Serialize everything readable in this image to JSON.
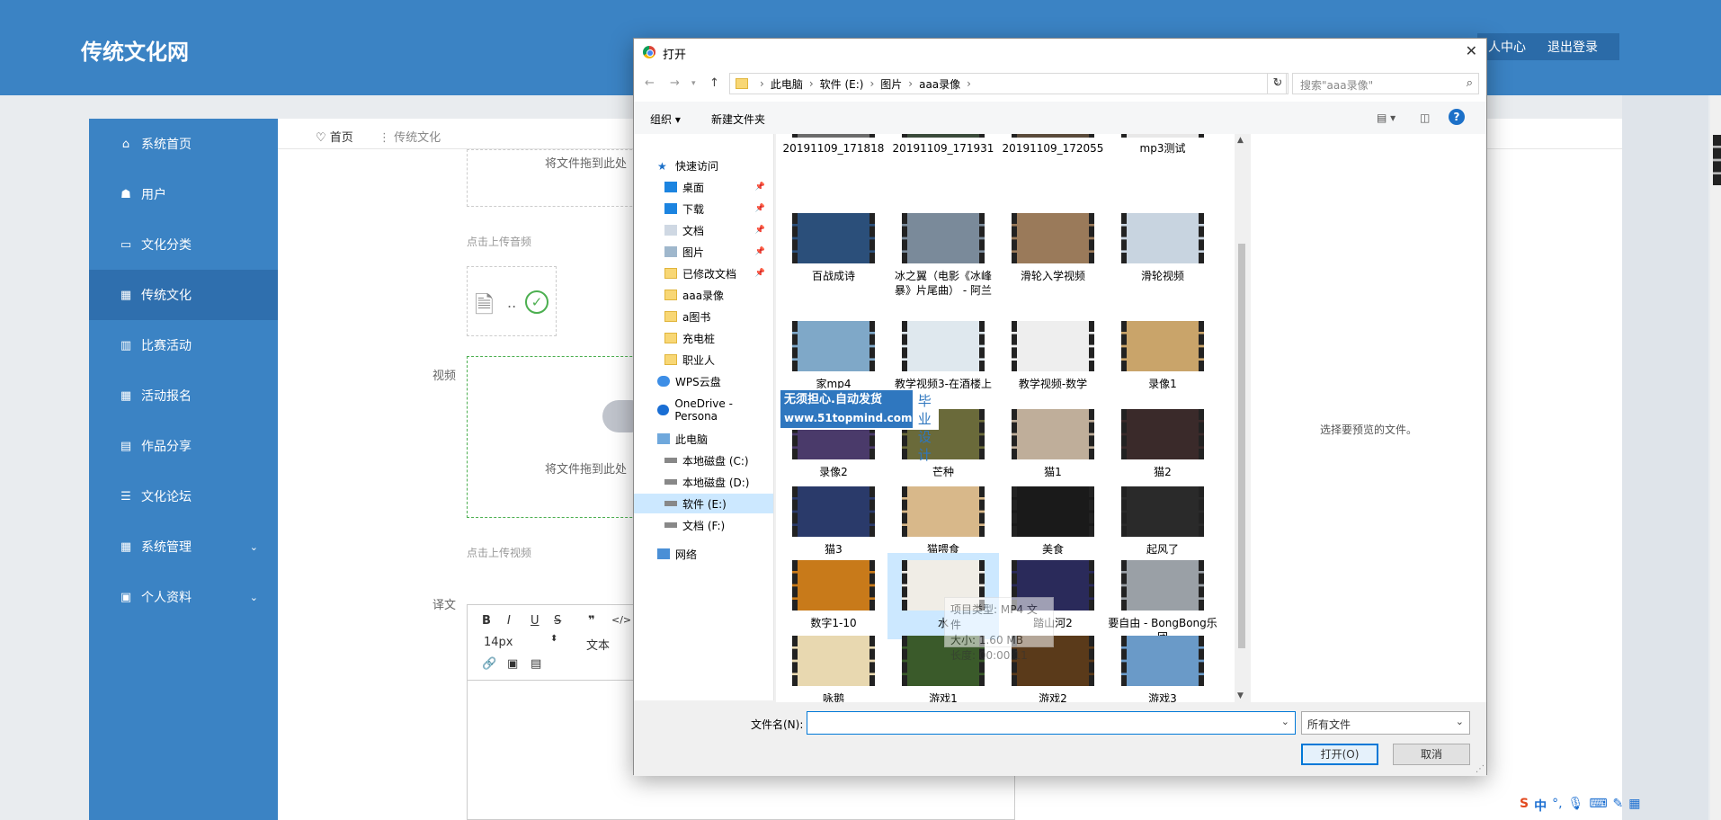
{
  "app": {
    "brand": "传统文化网",
    "top_buttons": [
      "人中心",
      "退出登录"
    ]
  },
  "sidebar": {
    "items": [
      {
        "icon": "home-icon",
        "label": "系统首页"
      },
      {
        "icon": "user-icon",
        "label": "用户"
      },
      {
        "icon": "monitor-icon",
        "label": "文化分类"
      },
      {
        "icon": "grid-icon",
        "label": "传统文化",
        "active": true
      },
      {
        "icon": "bar-chart-icon",
        "label": "比赛活动"
      },
      {
        "icon": "grid-icon",
        "label": "活动报名"
      },
      {
        "icon": "comment-icon",
        "label": "作品分享"
      },
      {
        "icon": "list-icon",
        "label": "文化论坛"
      },
      {
        "icon": "grid-icon",
        "label": "系统管理",
        "has_chevron": true
      },
      {
        "icon": "profile-icon",
        "label": "个人资料",
        "has_chevron": true
      }
    ]
  },
  "breadcrumb": {
    "home": "首页",
    "current": "传统文化"
  },
  "form": {
    "drop_text_audio": "将文件拖到此处",
    "upload_audio_hint": "点击上传音频",
    "video_label": "视频",
    "drop_text_video": "将文件拖到此处",
    "upload_video_hint": "点击上传视频",
    "translation_label": "译文",
    "editor_font_size": "14px",
    "editor_text_type": "文本"
  },
  "dialog": {
    "title": "打开",
    "path": [
      "此电脑",
      "软件 (E:)",
      "图片",
      "aaa录像"
    ],
    "search_placeholder": "搜索\"aaa录像\"",
    "toolbar": {
      "organize": "组织 ▾",
      "new_folder": "新建文件夹"
    },
    "nav": {
      "quick_access": "快速访问",
      "quick_items": [
        {
          "label": "桌面",
          "pinned": true
        },
        {
          "label": "下载",
          "pinned": true
        },
        {
          "label": "文档",
          "pinned": true
        },
        {
          "label": "图片",
          "pinned": true
        },
        {
          "label": "已修改文档",
          "pinned": true
        },
        {
          "label": "aaa录像",
          "pinned": false
        },
        {
          "label": "a图书",
          "pinned": false
        },
        {
          "label": "充电桩",
          "pinned": false
        },
        {
          "label": "职业人",
          "pinned": false
        }
      ],
      "wps": "WPS云盘",
      "onedrive": "OneDrive - Persona",
      "this_pc": "此电脑",
      "drives": [
        "本地磁盘 (C:)",
        "本地磁盘 (D:)",
        "软件 (E:)",
        "文档 (F:)"
      ],
      "selected_drive": "软件 (E:)",
      "network": "网络"
    },
    "files": [
      {
        "name": "20191109_171818",
        "color": "#6b6b6b"
      },
      {
        "name": "20191109_171931",
        "color": "#3a4a3a"
      },
      {
        "name": "20191109_172055",
        "color": "#5a4a3a"
      },
      {
        "name": "mp3测试",
        "color": "#e8e8e8"
      },
      {
        "name": "百战成诗",
        "color": "#2b4f7a"
      },
      {
        "name": "冰之翼（电影《冰峰暴》片尾曲） - 阿兰",
        "color": "#7a8a9a"
      },
      {
        "name": "滑轮入学视频",
        "color": "#9a7a5a"
      },
      {
        "name": "滑轮视频",
        "color": "#c8d4e0"
      },
      {
        "name": "家mp4",
        "color": "#7fa8c8"
      },
      {
        "name": "教学视频3-在酒楼上",
        "color": "#dfe8ee"
      },
      {
        "name": "教学视频-数学",
        "color": "#eeeeee"
      },
      {
        "name": "录像1",
        "color": "#c9a46a"
      },
      {
        "name": "录像2",
        "color": "#4a3a6a"
      },
      {
        "name": "芒种",
        "color": "#6a6a3a"
      },
      {
        "name": "猫1",
        "color": "#bfae9a"
      },
      {
        "name": "猫2",
        "color": "#3a2a2a"
      },
      {
        "name": "猫3",
        "color": "#2a3a6a"
      },
      {
        "name": "猫喂食",
        "color": "#d8b88a"
      },
      {
        "name": "美食",
        "color": "#1a1a1a"
      },
      {
        "name": "起风了",
        "color": "#2a2a2a"
      },
      {
        "name": "数字1-10",
        "color": "#c87a1a"
      },
      {
        "name": "水",
        "color": "#f0ede6",
        "selected": true
      },
      {
        "name": "踏山河2",
        "color": "#2a2a5a"
      },
      {
        "name": "要自由 - BongBong乐团",
        "color": "#9aa0a6"
      },
      {
        "name": "咏鹅",
        "color": "#e8d8b0"
      },
      {
        "name": "游戏1",
        "color": "#3a5a2a"
      },
      {
        "name": "游戏2",
        "color": "#5a3a1a"
      },
      {
        "name": "游戏3",
        "color": "#6a9ac8"
      }
    ],
    "preview_text": "选择要预览的文件。",
    "filename_label": "文件名(N):",
    "filename_value": "",
    "filetype": "所有文件",
    "open_button": "打开(O)",
    "cancel_button": "取消",
    "tooltip": [
      "项目类型: MP4 文件",
      "大小: 1.60 MB",
      "长度: 00:00:11"
    ]
  },
  "watermark": {
    "line1": "无须担心.自动发货",
    "line2": "www.51topmind.com",
    "right1": "毕业",
    "right2": "设计"
  },
  "tray": {
    "ime": "中"
  }
}
